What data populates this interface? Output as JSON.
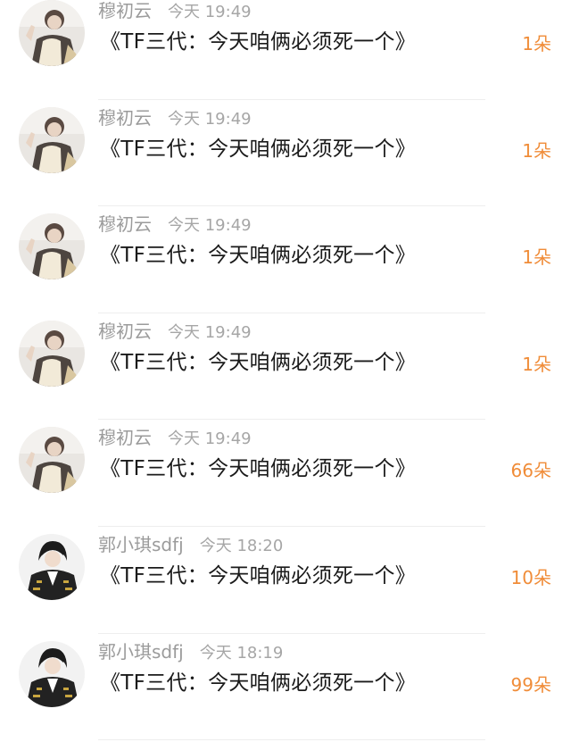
{
  "colors": {
    "count": "#f08c38",
    "meta": "#9b9b9b",
    "title": "#1a1a1a",
    "divider": "#eeeeee"
  },
  "messages": [
    {
      "avatar": "avatar-a",
      "name": "穆初云",
      "time": "今天 19:49",
      "title": "《TF三代：今天咱俩必须死一个》",
      "count": "1朵"
    },
    {
      "avatar": "avatar-a",
      "name": "穆初云",
      "time": "今天 19:49",
      "title": "《TF三代：今天咱俩必须死一个》",
      "count": "1朵"
    },
    {
      "avatar": "avatar-a",
      "name": "穆初云",
      "time": "今天 19:49",
      "title": "《TF三代：今天咱俩必须死一个》",
      "count": "1朵"
    },
    {
      "avatar": "avatar-a",
      "name": "穆初云",
      "time": "今天 19:49",
      "title": "《TF三代：今天咱俩必须死一个》",
      "count": "1朵"
    },
    {
      "avatar": "avatar-a",
      "name": "穆初云",
      "time": "今天 19:49",
      "title": "《TF三代：今天咱俩必须死一个》",
      "count": "66朵"
    },
    {
      "avatar": "avatar-b",
      "name": "郭小琪sdfj",
      "time": "今天 18:20",
      "title": "《TF三代：今天咱俩必须死一个》",
      "count": "10朵"
    },
    {
      "avatar": "avatar-b",
      "name": "郭小琪sdfj",
      "time": "今天 18:19",
      "title": "《TF三代：今天咱俩必须死一个》",
      "count": "99朵"
    }
  ]
}
